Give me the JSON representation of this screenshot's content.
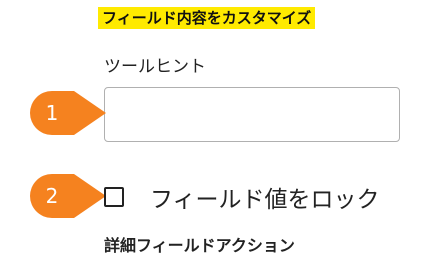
{
  "section": {
    "title": "フィールド内容をカスタマイズ",
    "highlight_color": "#ffea00"
  },
  "tooltip": {
    "label": "ツールヒント",
    "value": "",
    "placeholder": ""
  },
  "lock_field": {
    "label": "フィールド値をロック",
    "checked": false
  },
  "advanced": {
    "label": "詳細フィールドアクション"
  },
  "callouts": [
    {
      "number": "1",
      "color": "#f5821f"
    },
    {
      "number": "2",
      "color": "#f5821f"
    }
  ]
}
